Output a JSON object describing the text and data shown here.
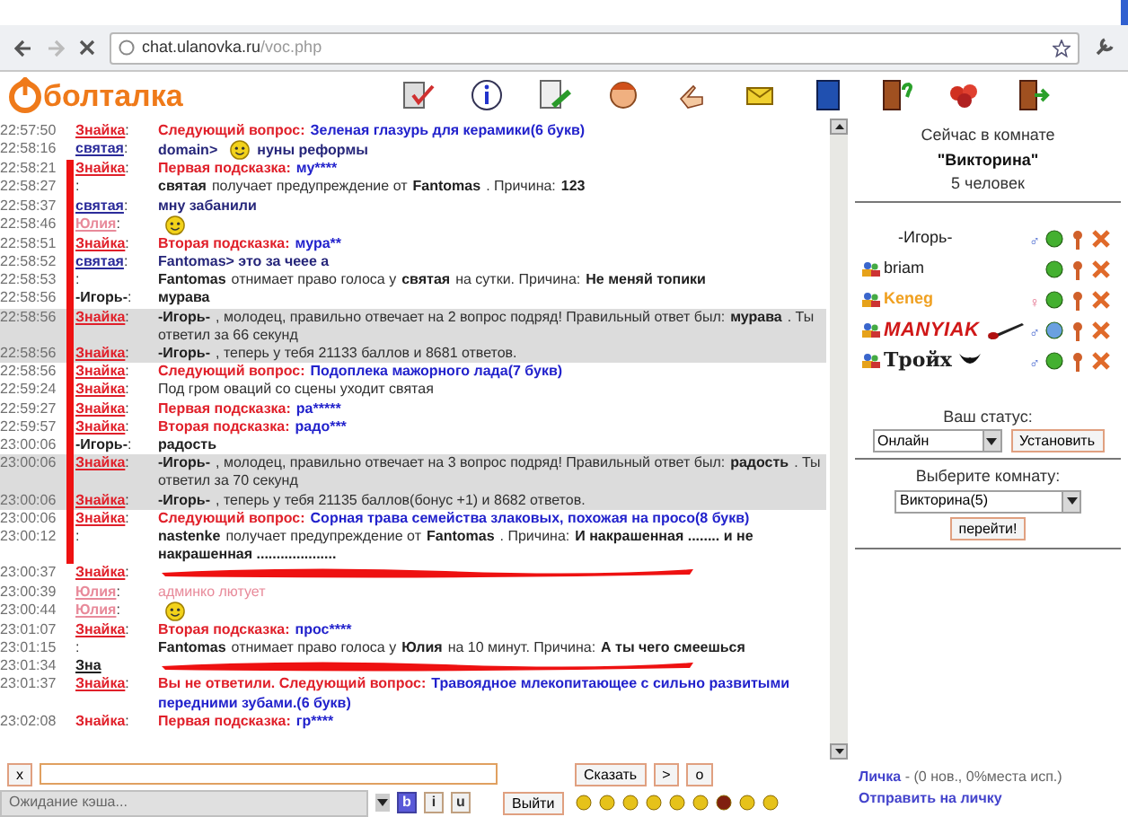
{
  "browser": {
    "url_host": "chat.ulanovka.ru",
    "url_path": "/voc.php"
  },
  "logo": {
    "text": "болталка"
  },
  "chat": {
    "messages": [
      {
        "time": "22:57:50",
        "nick": "Знайка",
        "color": "#e0202a",
        "link": true,
        "sep": ":",
        "highlighted": false,
        "marked": false,
        "scribbled": false,
        "parts": [
          {
            "kind": "label",
            "text": "Следующий вопрос:"
          },
          {
            "kind": "answer",
            "text": "Зеленая глазурь для керамики(6 букв)"
          }
        ]
      },
      {
        "time": "22:58:16",
        "nick": "святая",
        "color": "#2b2b9a",
        "link": true,
        "sep": ":",
        "highlighted": false,
        "marked": false,
        "scribbled": false,
        "parts": [
          {
            "kind": "navy",
            "text": "domain>"
          },
          {
            "kind": "smiley"
          },
          {
            "kind": "navy",
            "text": "нуны реформы"
          }
        ]
      },
      {
        "time": "22:58:21",
        "nick": "Знайка",
        "color": "#e0202a",
        "link": true,
        "sep": ":",
        "highlighted": false,
        "marked": true,
        "scribbled": false,
        "parts": [
          {
            "kind": "label",
            "text": "Первая подсказка:"
          },
          {
            "kind": "answer",
            "text": "му****"
          }
        ]
      },
      {
        "time": "22:58:27",
        "sep": ":",
        "highlighted": false,
        "marked": true,
        "scribbled": false,
        "parts": [
          {
            "kind": "bold",
            "text": "святая"
          },
          {
            "kind": "text",
            "text": "получает предупреждение от"
          },
          {
            "kind": "bold",
            "text": "Fantomas"
          },
          {
            "kind": "text",
            "text": ". Причина:"
          },
          {
            "kind": "bold",
            "text": "123"
          }
        ]
      },
      {
        "time": "22:58:37",
        "nick": "святая",
        "color": "#2b2b9a",
        "link": true,
        "sep": ":",
        "highlighted": false,
        "marked": true,
        "scribbled": false,
        "parts": [
          {
            "kind": "navy",
            "text": "мну забанили"
          }
        ]
      },
      {
        "time": "22:58:46",
        "nick": "Юлия",
        "color": "#e88a9a",
        "link": true,
        "sep": ":",
        "highlighted": false,
        "marked": true,
        "scribbled": false,
        "parts": [
          {
            "kind": "smiley"
          }
        ]
      },
      {
        "time": "22:58:51",
        "nick": "Знайка",
        "color": "#e0202a",
        "link": true,
        "sep": ":",
        "highlighted": false,
        "marked": true,
        "scribbled": false,
        "parts": [
          {
            "kind": "label",
            "text": "Вторая подсказка:"
          },
          {
            "kind": "answer",
            "text": "мура**"
          }
        ]
      },
      {
        "time": "22:58:52",
        "nick": "святая",
        "color": "#2b2b9a",
        "link": true,
        "sep": ":",
        "highlighted": false,
        "marked": true,
        "scribbled": false,
        "parts": [
          {
            "kind": "navy",
            "text": "Fantomas> это за чеее а"
          }
        ]
      },
      {
        "time": "22:58:53",
        "sep": ":",
        "highlighted": false,
        "marked": true,
        "scribbled": false,
        "parts": [
          {
            "kind": "bold",
            "text": "Fantomas"
          },
          {
            "kind": "text",
            "text": "отнимает право голоса у"
          },
          {
            "kind": "bold",
            "text": "святая"
          },
          {
            "kind": "text",
            "text": "на сутки. Причина:"
          },
          {
            "kind": "bold",
            "text": "Не меняй топики"
          }
        ]
      },
      {
        "time": "22:58:56",
        "nick": "-Игорь-",
        "color": "#202020",
        "link": false,
        "sep": ":",
        "highlighted": false,
        "marked": true,
        "scribbled": false,
        "parts": [
          {
            "kind": "bold",
            "text": "мурава"
          }
        ]
      },
      {
        "time": "22:58:56",
        "nick": "Знайка",
        "color": "#e0202a",
        "link": true,
        "sep": ":",
        "highlighted": true,
        "marked": true,
        "scribbled": false,
        "parts": [
          {
            "kind": "bold",
            "text": "-Игорь-"
          },
          {
            "kind": "text",
            "text": ", молодец, правильно отвечает на 2 вопрос подряд! Правильный ответ был:"
          },
          {
            "kind": "bold",
            "text": "мурава"
          },
          {
            "kind": "text",
            "text": ". Ты ответил за 66 секунд"
          }
        ]
      },
      {
        "time": "22:58:56",
        "nick": "Знайка",
        "color": "#e0202a",
        "link": true,
        "sep": ":",
        "highlighted": true,
        "marked": true,
        "scribbled": false,
        "parts": [
          {
            "kind": "bold",
            "text": "-Игорь-"
          },
          {
            "kind": "text",
            "text": ", теперь у тебя 21133 баллов и 8681 ответов."
          }
        ]
      },
      {
        "time": "22:58:56",
        "nick": "Знайка",
        "color": "#e0202a",
        "link": true,
        "sep": ":",
        "highlighted": false,
        "marked": true,
        "scribbled": false,
        "parts": [
          {
            "kind": "label",
            "text": "Следующий вопрос:"
          },
          {
            "kind": "answer",
            "text": "Подоплека мажорного лада(7 букв)"
          }
        ]
      },
      {
        "time": "22:59:24",
        "nick": "Знайка",
        "color": "#e0202a",
        "link": true,
        "sep": ":",
        "highlighted": false,
        "marked": true,
        "scribbled": false,
        "parts": [
          {
            "kind": "text",
            "text": "Под гром оваций со сцены уходит святая"
          }
        ]
      },
      {
        "time": "22:59:27",
        "nick": "Знайка",
        "color": "#e0202a",
        "link": true,
        "sep": ":",
        "highlighted": false,
        "marked": true,
        "scribbled": false,
        "parts": [
          {
            "kind": "label",
            "text": "Первая подсказка:"
          },
          {
            "kind": "answer",
            "text": "ра*****"
          }
        ]
      },
      {
        "time": "22:59:57",
        "nick": "Знайка",
        "color": "#e0202a",
        "link": true,
        "sep": ":",
        "highlighted": false,
        "marked": true,
        "scribbled": false,
        "parts": [
          {
            "kind": "label",
            "text": "Вторая подсказка:"
          },
          {
            "kind": "answer",
            "text": "радо***"
          }
        ]
      },
      {
        "time": "23:00:06",
        "nick": "-Игорь-",
        "color": "#202020",
        "link": false,
        "sep": ":",
        "highlighted": false,
        "marked": true,
        "scribbled": false,
        "parts": [
          {
            "kind": "bold",
            "text": "радость"
          }
        ]
      },
      {
        "time": "23:00:06",
        "nick": "Знайка",
        "color": "#e0202a",
        "link": true,
        "sep": ":",
        "highlighted": true,
        "marked": true,
        "scribbled": false,
        "parts": [
          {
            "kind": "bold",
            "text": "-Игорь-"
          },
          {
            "kind": "text",
            "text": ", молодец, правильно отвечает на 3 вопрос подряд! Правильный ответ был:"
          },
          {
            "kind": "bold",
            "text": "радость"
          },
          {
            "kind": "text",
            "text": ". Ты ответил за 70 секунд"
          }
        ]
      },
      {
        "time": "23:00:06",
        "nick": "Знайка",
        "color": "#e0202a",
        "link": true,
        "sep": ":",
        "highlighted": true,
        "marked": true,
        "scribbled": false,
        "parts": [
          {
            "kind": "bold",
            "text": "-Игорь-"
          },
          {
            "kind": "text",
            "text": ", теперь у тебя 21135 баллов(бонус +1) и 8682 ответов."
          }
        ]
      },
      {
        "time": "23:00:06",
        "nick": "Знайка",
        "color": "#e0202a",
        "link": true,
        "sep": ":",
        "highlighted": false,
        "marked": true,
        "scribbled": false,
        "parts": [
          {
            "kind": "label",
            "text": "Следующий вопрос:"
          },
          {
            "kind": "answer",
            "text": "Сорная трава семейства злаковых, похожая на просо(8 букв)"
          }
        ]
      },
      {
        "time": "23:00:12",
        "sep": ":",
        "highlighted": false,
        "marked": true,
        "scribbled": false,
        "parts": [
          {
            "kind": "bold",
            "text": "nastenke"
          },
          {
            "kind": "text",
            "text": "получает предупреждение от"
          },
          {
            "kind": "bold",
            "text": "Fantomas"
          },
          {
            "kind": "text",
            "text": ". Причина:"
          },
          {
            "kind": "bold",
            "text": "И накрашенная ........ и не накрашенная ...................."
          }
        ]
      },
      {
        "time": "23:00:37",
        "nick": "Знайка",
        "color": "#e0202a",
        "link": true,
        "sep": ":",
        "highlighted": false,
        "marked": false,
        "scribbled": true
      },
      {
        "time": "23:00:39",
        "nick": "Юлия",
        "color": "#e88a9a",
        "link": true,
        "sep": ":",
        "highlighted": false,
        "marked": false,
        "scribbled": false,
        "parts": [
          {
            "kind": "pink",
            "text": "админко лютует"
          }
        ]
      },
      {
        "time": "23:00:44",
        "nick": "Юлия",
        "color": "#e88a9a",
        "link": true,
        "sep": ":",
        "highlighted": false,
        "marked": false,
        "scribbled": false,
        "parts": [
          {
            "kind": "smiley"
          }
        ]
      },
      {
        "time": "23:01:07",
        "nick": "Знайка",
        "color": "#e0202a",
        "link": true,
        "sep": ":",
        "highlighted": false,
        "marked": false,
        "scribbled": false,
        "parts": [
          {
            "kind": "label",
            "text": "Вторая подсказка:"
          },
          {
            "kind": "answer",
            "text": "прос****"
          }
        ]
      },
      {
        "time": "23:01:15",
        "sep": ":",
        "highlighted": false,
        "marked": false,
        "scribbled": false,
        "parts": [
          {
            "kind": "bold",
            "text": "Fantomas"
          },
          {
            "kind": "text",
            "text": "отнимает право голоса у"
          },
          {
            "kind": "bold",
            "text": "Юлия"
          },
          {
            "kind": "text",
            "text": "на 10 минут. Причина:"
          },
          {
            "kind": "bold",
            "text": "А ты чего смеешься"
          }
        ]
      },
      {
        "time": "23:01:34",
        "nick": "Зна",
        "color": "#202020",
        "link": true,
        "highlighted": false,
        "marked": false,
        "scribbled": true
      },
      {
        "time": "23:01:37",
        "nick": "Знайка",
        "color": "#e0202a",
        "link": true,
        "sep": ":",
        "highlighted": false,
        "marked": false,
        "scribbled": false,
        "parts": [
          {
            "kind": "label",
            "text": "Вы не ответили. Следующий вопрос:"
          },
          {
            "kind": "answer",
            "text": "Травоядное млекопитающее с сильно развитыми передними зубами.(6 букв)"
          }
        ]
      },
      {
        "time": "23:02:08",
        "nick": "Знайка",
        "color": "#e0202a",
        "link": false,
        "sep": ":",
        "highlighted": false,
        "marked": false,
        "scribbled": false,
        "parts": [
          {
            "kind": "label",
            "text": "Первая подсказка:"
          },
          {
            "kind": "answer",
            "text": "гр****"
          }
        ]
      }
    ]
  },
  "input": {
    "clear": "x",
    "send": "Сказать",
    "buttons": [
      ">",
      "o"
    ]
  },
  "status_bar": {
    "text": "Ожидание кэша..."
  },
  "format_buttons": [
    {
      "label": "b",
      "selected": true
    },
    {
      "label": "i",
      "selected": false
    },
    {
      "label": "u",
      "selected": false
    }
  ],
  "exit": "Выйти",
  "room": {
    "heading": "Сейчас в комнате",
    "name": "\"Викторина\"",
    "count": "5 человек",
    "users": [
      {
        "kind": "plain",
        "name": "-Игорь-",
        "avatar": false,
        "gender": "♂",
        "away": false
      },
      {
        "kind": "plain",
        "name": "briam",
        "avatar": true,
        "away": false
      },
      {
        "kind": "bold",
        "name": "Keneg",
        "color": "#f0a020",
        "avatar": true,
        "gender": "♀",
        "away": false
      },
      {
        "kind": "graffiti",
        "name": "MANYIAK",
        "color": "#d01818",
        "avatar": true,
        "gender": "♂",
        "away": true
      },
      {
        "kind": "gothic",
        "name": "Тройх",
        "avatar": true,
        "gender": "♂",
        "away": false
      }
    ]
  },
  "status_form": {
    "label": "Ваш статус:",
    "value": "Онлайн",
    "button": "Установить"
  },
  "room_form": {
    "label": "Выберите комнату:",
    "value": "Викторина(5)",
    "button": "перейти!"
  },
  "private": {
    "link": "Личка",
    "info": " - (0 нов., 0%места исп.)",
    "send": "Отправить на личку"
  }
}
